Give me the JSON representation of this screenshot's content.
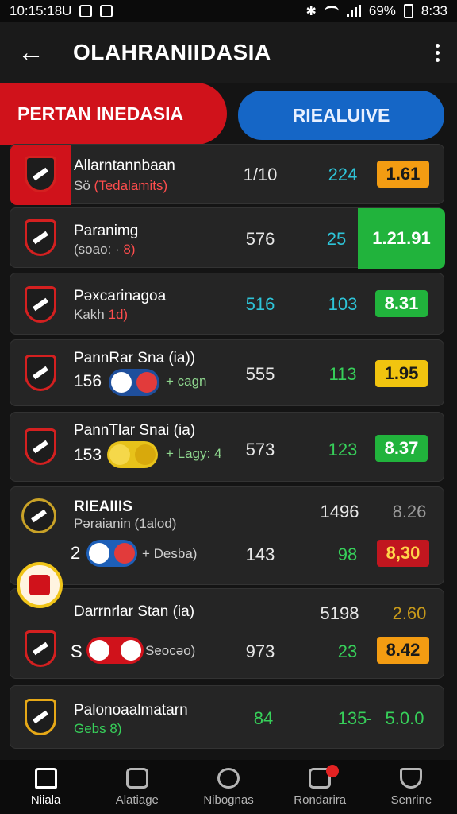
{
  "status": {
    "time": "10:15:18U",
    "battery": "69%",
    "clock": "8:33"
  },
  "appbar": {
    "title": "OLAHRANIIDASIA"
  },
  "tabs": {
    "left": "PERTAN INEDASIA",
    "right": "RIEALUIVE"
  },
  "rows": [
    {
      "name": "Allarntannbaan",
      "sub": "Sö",
      "sub_red": "(Tedalamits)",
      "c1": "1/10",
      "c2": "224",
      "badge": "1.61"
    },
    {
      "name": "Paranimg",
      "sub": "(soao: ·",
      "sub_red": "8)",
      "c1": "576",
      "c2": "25",
      "badge": "1.21.91"
    },
    {
      "name": "Pəxcarinagoa",
      "sub": "Kakh",
      "sub_red": "1d)",
      "c1": "516",
      "c2": "103",
      "badge": "8.31"
    },
    {
      "name": "PannRar Sna (ia))",
      "sub": "156",
      "extra": "+ cagn",
      "c1": "555",
      "c2": "113",
      "badge": "1.95"
    },
    {
      "name": "PannTlar Snai (ia)",
      "sub": "153",
      "extra": "+ Lagy: 4",
      "c1": "573",
      "c2": "123",
      "badge": "8.37"
    },
    {
      "name": "RIEAIIIS",
      "sub": "Pəraianin (1alod)",
      "lead": "2",
      "extra": "+ Desba)",
      "c1": "1496",
      "c1b": "143",
      "c2": "98",
      "top_val": "8.26",
      "badge": "8,30"
    },
    {
      "name": "Darrnrlar Stan (ia)",
      "lead": "S",
      "extra": "Seocəo)",
      "c1": "5198",
      "c1b": "973",
      "c2": "23",
      "top_val": "2.60",
      "badge": "8.42"
    },
    {
      "name": "Palonoaalmatarn",
      "sub": "Gebs",
      "sub_red": "8)",
      "c1": "84",
      "c2": "135",
      "sep": "-",
      "badge": "5.0.0"
    }
  ],
  "nav": [
    "Niiala",
    "Alatiage",
    "Nibognas",
    "Rondarira",
    "Senrine"
  ],
  "colors": {
    "accent_red": "#d0121b",
    "accent_blue": "#1566c6",
    "green": "#21b33c"
  }
}
